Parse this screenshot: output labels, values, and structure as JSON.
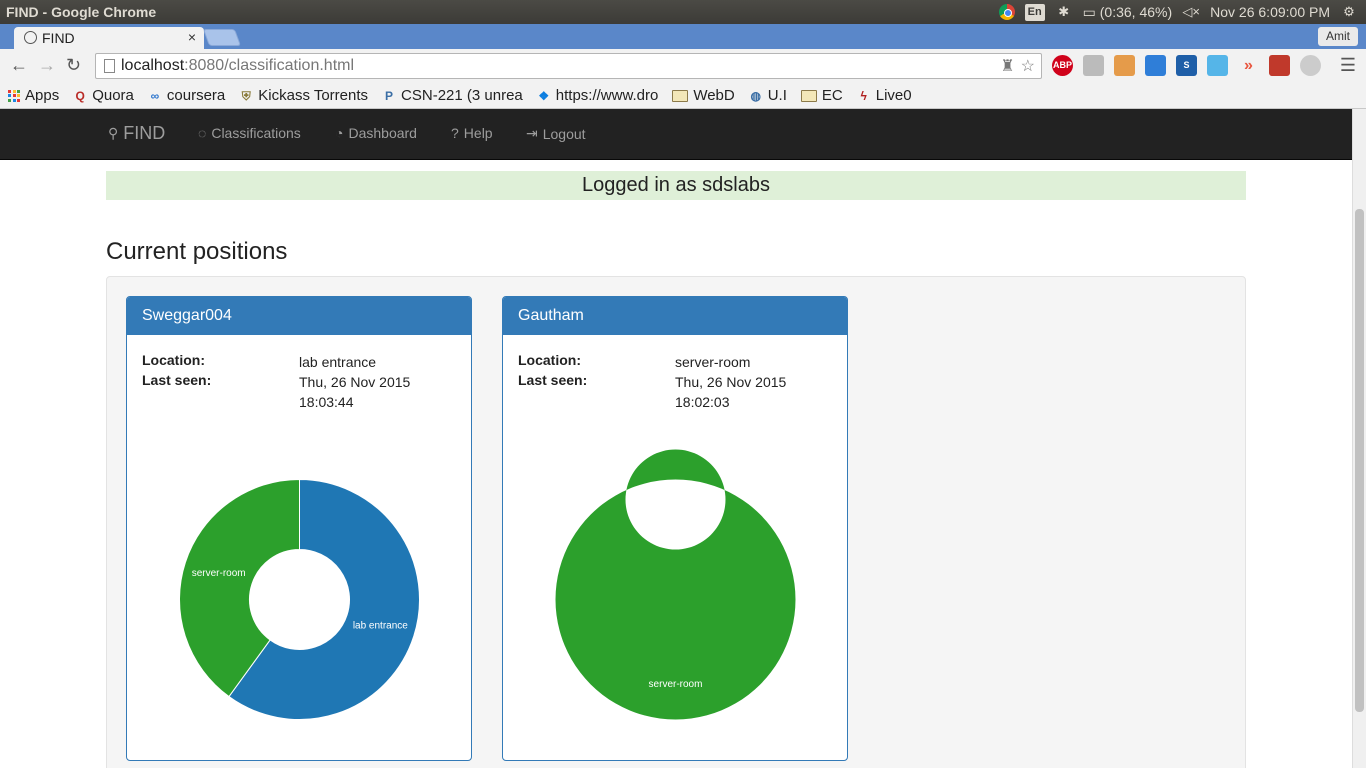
{
  "os": {
    "window_title": "FIND - Google Chrome",
    "lang": "En",
    "battery": "(0:36, 46%)",
    "datetime": "Nov 26  6:09:00 PM"
  },
  "browser": {
    "tab_title": "FIND",
    "tab_close": "×",
    "profile": "Amit",
    "url_host": "localhost",
    "url_rest": ":8080/classification.html",
    "bookmarks": [
      {
        "label": "Apps",
        "icon": "apps-grid-icon"
      },
      {
        "label": "Quora",
        "icon": "quora-icon"
      },
      {
        "label": "coursera",
        "icon": "coursera-icon"
      },
      {
        "label": "Kickass Torrents",
        "icon": "kickass-icon"
      },
      {
        "label": "CSN-221 (3 unrea",
        "icon": "csn-icon"
      },
      {
        "label": "https://www.dro",
        "icon": "dropbox-icon"
      },
      {
        "label": "WebD",
        "icon": "folder-icon"
      },
      {
        "label": "U.I",
        "icon": "globe-icon"
      },
      {
        "label": "EC",
        "icon": "folder-icon"
      },
      {
        "label": "Live0",
        "icon": "live-icon"
      }
    ]
  },
  "nav": {
    "brand": "FIND",
    "items": [
      "Classifications",
      "Dashboard",
      "Help",
      "Logout"
    ]
  },
  "alert": "Logged in as sdslabs",
  "section_title": "Current positions",
  "labels": {
    "location": "Location:",
    "last_seen": "Last seen:"
  },
  "cards": [
    {
      "name": "Sweggar004",
      "location": "lab entrance",
      "last_seen_date": "Thu, 26 Nov 2015",
      "last_seen_time": "18:03:44"
    },
    {
      "name": "Gautham",
      "location": "server-room",
      "last_seen_date": "Thu, 26 Nov 2015",
      "last_seen_time": "18:02:03"
    }
  ],
  "colors": {
    "primary": "#337ab7",
    "lab_entrance": "#1f77b4",
    "server_room": "#2ca02c",
    "navbar": "#222222",
    "alert_bg": "#dff0d8"
  },
  "chart_data": [
    {
      "type": "pie",
      "categories": [
        "lab entrance",
        "server-room"
      ],
      "values": [
        60,
        40
      ],
      "colors": [
        "#1f77b4",
        "#2ca02c"
      ]
    },
    {
      "type": "pie",
      "categories": [
        "server-room"
      ],
      "values": [
        100
      ],
      "colors": [
        "#2ca02c"
      ]
    }
  ]
}
